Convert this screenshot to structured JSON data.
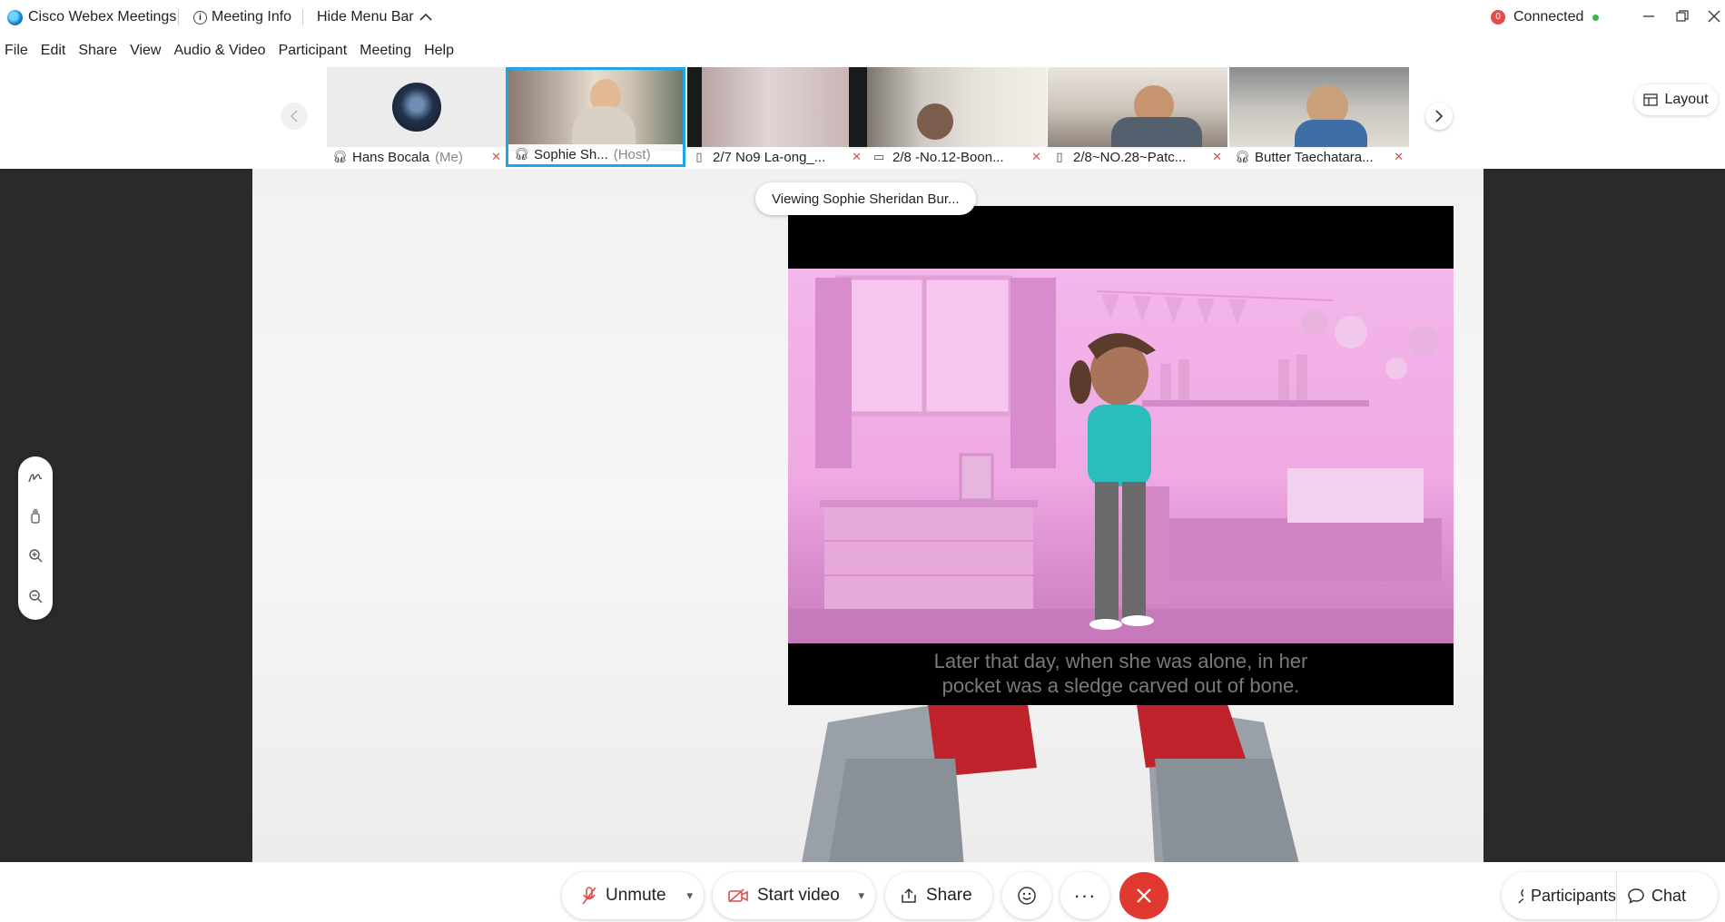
{
  "titlebar": {
    "app_title": "Cisco Webex Meetings",
    "meeting_info_label": "Meeting Info",
    "hide_menu_label": "Hide Menu Bar",
    "connection_label": "Connected",
    "connection_badge": "0"
  },
  "menu": {
    "items": [
      "File",
      "Edit",
      "Share",
      "View",
      "Audio & Video",
      "Participant",
      "Meeting",
      "Help"
    ]
  },
  "filmstrip": {
    "participants": [
      {
        "name": "Hans Bocala",
        "suffix": "(Me)",
        "device": "headset-icon",
        "muted": true,
        "active": false
      },
      {
        "name": "Sophie Sh...",
        "suffix": "(Host)",
        "device": "headset-icon",
        "muted": false,
        "active": true
      },
      {
        "name": "2/7 No9 La-ong_...",
        "suffix": "",
        "device": "phone-icon",
        "muted": true,
        "active": false
      },
      {
        "name": "2/8 -No.12-Boon...",
        "suffix": "",
        "device": "tablet-icon",
        "muted": true,
        "active": false
      },
      {
        "name": "2/8~NO.28~Patc...",
        "suffix": "",
        "device": "phone-icon",
        "muted": true,
        "active": false
      },
      {
        "name": "Butter Taechatara...",
        "suffix": "",
        "device": "headset-icon",
        "muted": true,
        "active": false
      }
    ],
    "layout_label": "Layout"
  },
  "stage": {
    "viewing_label": "Viewing Sophie Sheridan Bur...",
    "caption_line1": "Later that day, when she was alone, in her",
    "caption_line2": "pocket was a sledge carved out of bone."
  },
  "controls": {
    "unmute_label": "Unmute",
    "start_video_label": "Start video",
    "share_label": "Share",
    "more_label": "···",
    "participants_label": "Participants",
    "chat_label": "Chat"
  },
  "colors": {
    "accent": "#1ea7e1",
    "end_call": "#e0392f",
    "muted_red": "#d9534f",
    "connected_green": "#3cb54a"
  }
}
